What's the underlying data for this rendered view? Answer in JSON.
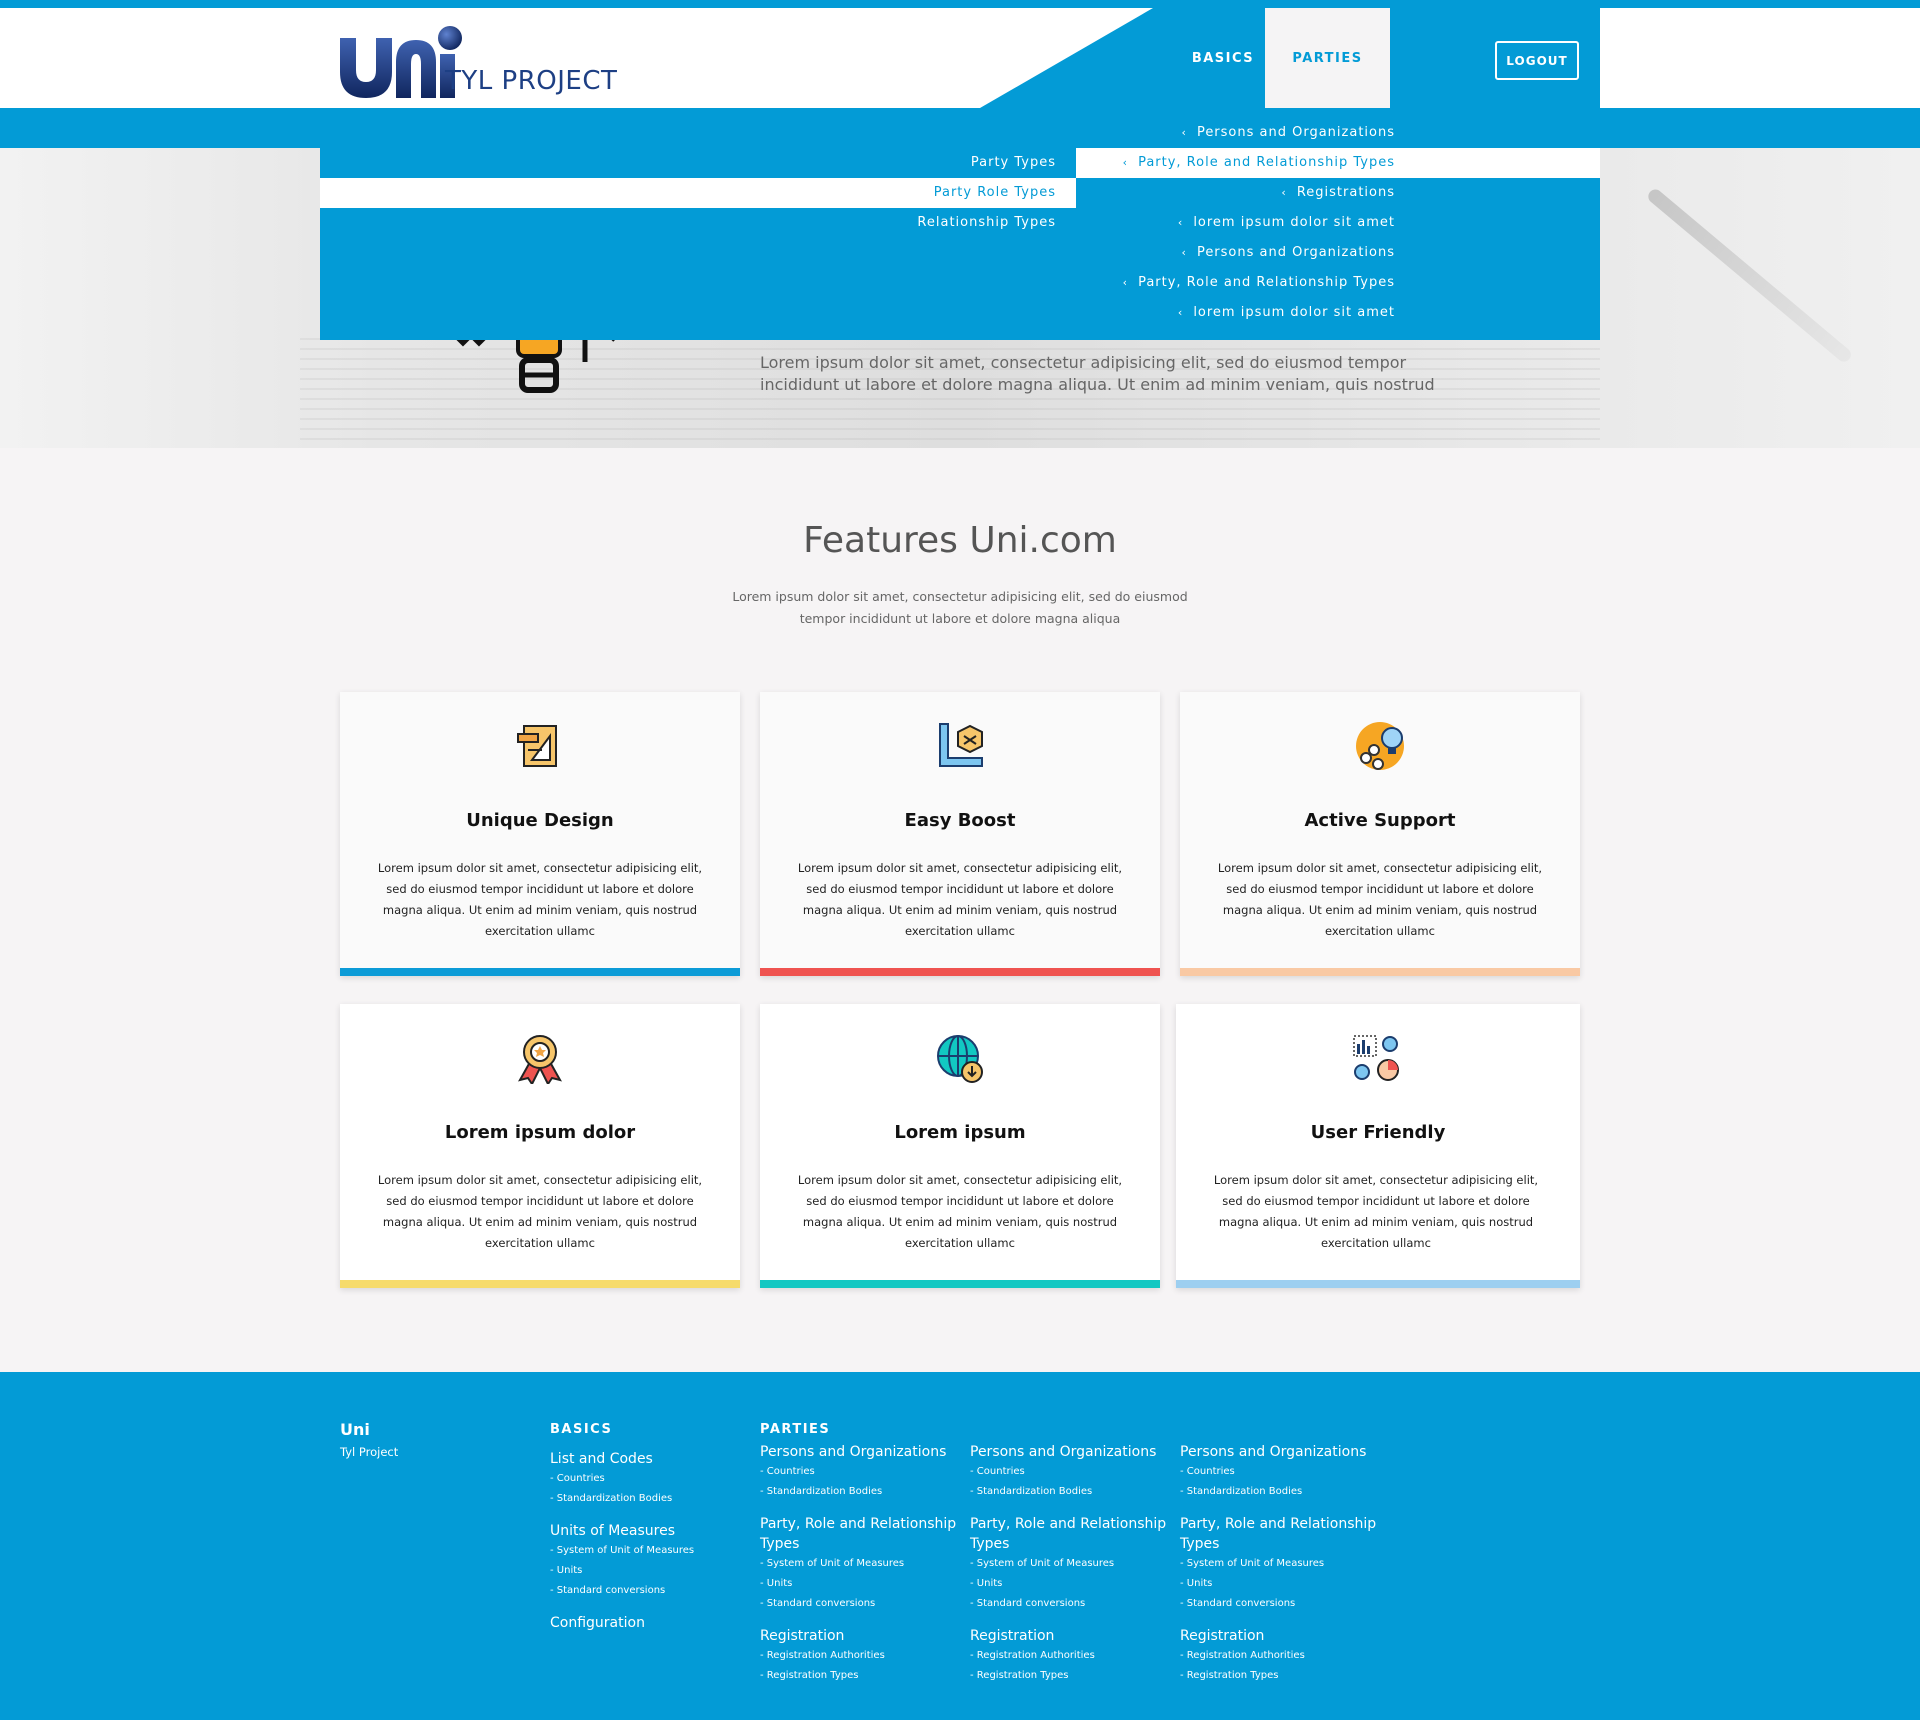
{
  "header": {
    "logo_text": "TYL PROJECT",
    "nav": {
      "basics": "BASICS",
      "parties": "PARTIES"
    },
    "logout": "LOGOUT"
  },
  "dropdown": {
    "left_items": [
      "Party Types",
      "Party Role Types",
      "Relationship Types"
    ],
    "left_active_index": 1,
    "right_items": [
      "Persons and Organizations",
      "Party, Role and Relationship Types",
      "Registrations",
      "lorem ipsum dolor sit amet",
      "Persons and Organizations",
      "Party, Role and Relationship Types",
      "lorem ipsum dolor sit amet"
    ],
    "right_active_index": 1
  },
  "hero": {
    "text": "Lorem ipsum dolor sit amet, consectetur adipisicing elit, sed do eiusmod tempor incididunt ut labore et dolore magna aliqua. Ut enim ad minim veniam, quis nostrud"
  },
  "features": {
    "title": "Features Uni.com",
    "subtitle": "Lorem ipsum dolor sit amet, consectetur adipisicing elit, sed do eiusmod tempor incididunt ut labore et dolore magna aliqua",
    "cards": [
      {
        "title": "Unique Design",
        "text": "Lorem ipsum dolor sit amet, consectetur adipisicing elit, sed do eiusmod tempor incididunt ut labore et dolore magna aliqua. Ut enim ad minim veniam, quis nostrud exercitation ullamc",
        "icon": "design-icon",
        "accent": "#0c9bd7"
      },
      {
        "title": "Easy Boost",
        "text": "Lorem ipsum dolor sit amet, consectetur adipisicing elit, sed do eiusmod tempor incididunt ut labore et dolore magna aliqua. Ut enim ad minim veniam, quis nostrud exercitation ullamc",
        "icon": "cube-ruler-icon",
        "accent": "#ef5350"
      },
      {
        "title": "Active Support",
        "text": "Lorem ipsum dolor sit amet, consectetur adipisicing elit, sed do eiusmod tempor incididunt ut labore et dolore magna aliqua. Ut enim ad minim veniam, quis nostrud exercitation ullamc",
        "icon": "support-bulb-icon",
        "accent": "#f9c9a4"
      },
      {
        "title": "Lorem ipsum dolor",
        "text": "Lorem ipsum dolor sit amet, consectetur adipisicing elit, sed do eiusmod tempor incididunt ut labore et dolore magna aliqua. Ut enim ad minim veniam, quis nostrud exercitation ullamc",
        "icon": "award-badge-icon",
        "accent": "#f6db6b"
      },
      {
        "title": "Lorem ipsum",
        "text": "Lorem ipsum dolor sit amet, consectetur adipisicing elit, sed do eiusmod tempor incididunt ut labore et dolore magna aliqua. Ut enim ad minim veniam, quis nostrud exercitation ullamc",
        "icon": "globe-download-icon",
        "accent": "#12c8c2"
      },
      {
        "title": "User Friendly",
        "text": "Lorem ipsum dolor sit amet, consectetur adipisicing elit, sed do eiusmod tempor incididunt ut labore et dolore magna aliqua. Ut enim ad minim veniam, quis nostrud exercitation ullamc",
        "icon": "analytics-gear-icon",
        "accent": "#9dcff0"
      }
    ]
  },
  "footer": {
    "brand": "Uni",
    "brand_sub": "Tyl Project",
    "basics_head": "BASICS",
    "parties_head": "PARTIES",
    "basics": [
      {
        "title": "List and Codes",
        "items": [
          "- Countries",
          "- Standardization Bodies"
        ]
      },
      {
        "title": "Units of Measures",
        "items": [
          "- System of Unit of Measures",
          "- Units",
          "- Standard conversions"
        ]
      },
      {
        "title": "Configuration",
        "items": []
      }
    ],
    "parties_columns": [
      [
        {
          "title": "Persons and Organizations",
          "items": [
            "- Countries",
            "- Standardization Bodies"
          ]
        },
        {
          "title": "Party, Role and Relationship Types",
          "items": [
            "- System of Unit of Measures",
            "- Units",
            "- Standard conversions"
          ]
        },
        {
          "title": "Registration",
          "items": [
            "- Registration Authorities",
            "- Registration Types"
          ]
        }
      ],
      [
        {
          "title": "Persons and Organizations",
          "items": [
            "- Countries",
            "- Standardization Bodies"
          ]
        },
        {
          "title": "Party, Role and Relationship Types",
          "items": [
            "- System of Unit of Measures",
            "- Units",
            "- Standard conversions"
          ]
        },
        {
          "title": "Registration",
          "items": [
            "- Registration Authorities",
            "- Registration Types"
          ]
        }
      ],
      [
        {
          "title": "Persons and Organizations",
          "items": [
            "- Countries",
            "- Standardization Bodies"
          ]
        },
        {
          "title": "Party, Role and Relationship Types",
          "items": [
            "- System of Unit of Measures",
            "- Units",
            "- Standard conversions"
          ]
        },
        {
          "title": "Registration",
          "items": [
            "- Registration Authorities",
            "- Registration Types"
          ]
        }
      ]
    ]
  }
}
